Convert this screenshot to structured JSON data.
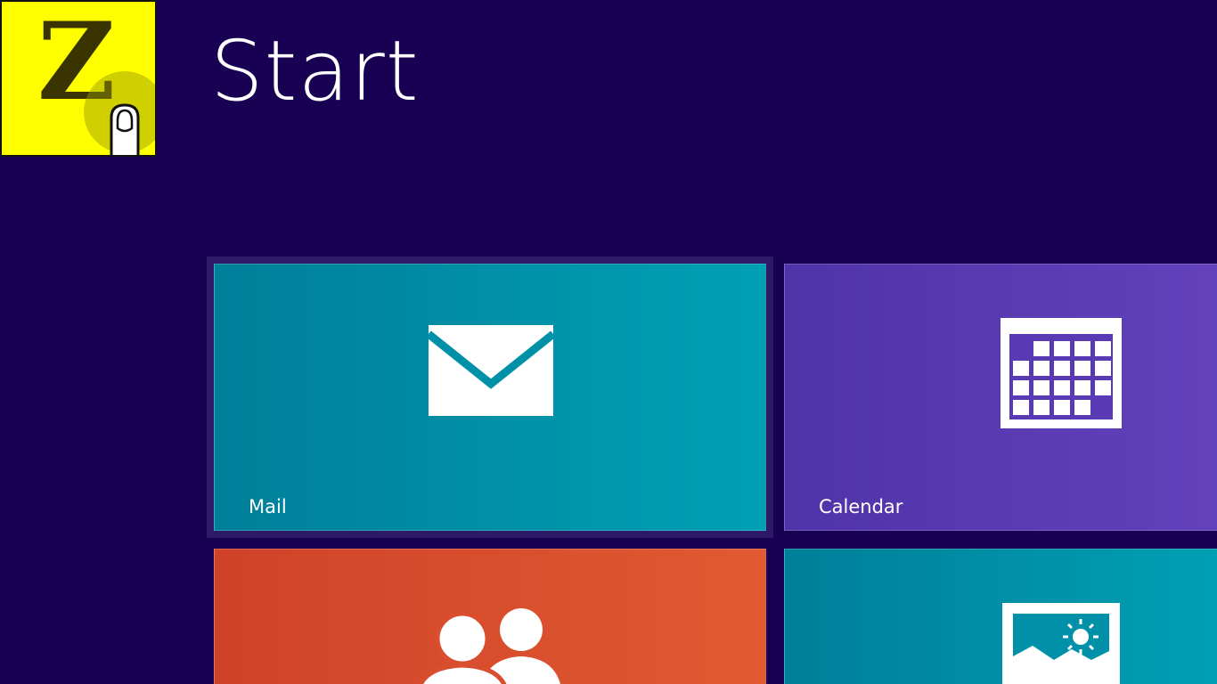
{
  "screen": {
    "title": "Start"
  },
  "logo": {
    "letter": "Z",
    "color": "#ffff00"
  },
  "colors": {
    "background": "#180052",
    "mail_tile": "#0091a8",
    "calendar_tile": "#5a3ab4",
    "people_tile": "#d84e2e",
    "photos_tile": "#0091a8"
  },
  "tiles": [
    {
      "label": "Mail",
      "icon": "mail-icon"
    },
    {
      "label": "Calendar",
      "icon": "calendar-icon"
    },
    {
      "label": "",
      "icon": "people-icon"
    },
    {
      "label": "",
      "icon": "photos-icon"
    }
  ]
}
